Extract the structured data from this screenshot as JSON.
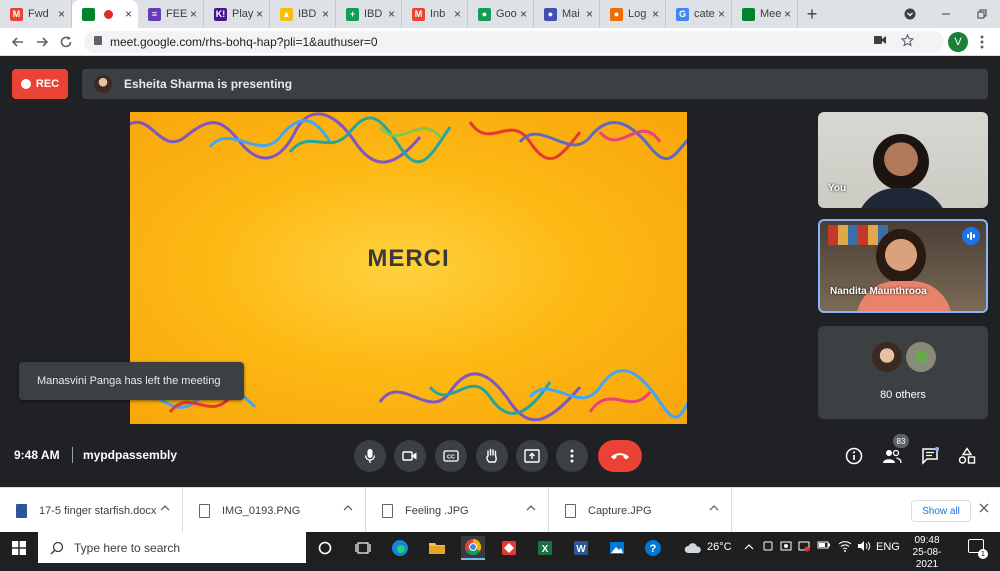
{
  "browser": {
    "tabs": [
      {
        "label": "Fwd",
        "icon": "gmail-icon",
        "color": "#ea4335",
        "glyph": "M"
      },
      {
        "label": "",
        "icon": "meet-icon",
        "color": "#00832d",
        "glyph": "",
        "active": true,
        "recording": true
      },
      {
        "label": "FEE",
        "icon": "forms-icon",
        "color": "#673ab7",
        "glyph": "≡"
      },
      {
        "label": "Play",
        "icon": "kahoot-icon",
        "color": "#46178f",
        "glyph": "K!"
      },
      {
        "label": "IBD",
        "icon": "drive-icon",
        "color": "#fbbc04",
        "glyph": "▲"
      },
      {
        "label": "IBD",
        "icon": "sheets-icon",
        "color": "#0f9d58",
        "glyph": "+"
      },
      {
        "label": "Inb",
        "icon": "gmail-icon",
        "color": "#ea4335",
        "glyph": "M"
      },
      {
        "label": "Goo",
        "icon": "google-icon",
        "color": "#0f9d58",
        "glyph": "●"
      },
      {
        "label": "Mai",
        "icon": "globe-icon",
        "color": "#3f51b5",
        "glyph": "●"
      },
      {
        "label": "Log",
        "icon": "login-icon",
        "color": "#ef6c00",
        "glyph": "●"
      },
      {
        "label": "cate",
        "icon": "google-g-icon",
        "color": "#4285f4",
        "glyph": "G"
      },
      {
        "label": "Mee",
        "icon": "meet-icon",
        "color": "#00832d",
        "glyph": ""
      }
    ],
    "new_tab_label": "+",
    "url": "meet.google.com/rhs-bohq-hap?pli=1&authuser=0",
    "profile_initial": "V"
  },
  "meet": {
    "rec_label": "REC",
    "presenting_text": "Esheita Sharma is presenting",
    "slide_title": "MERCI",
    "toast": "Manasvini Panga has left the meeting",
    "tiles": {
      "you": "You",
      "nandita": "Nandita Maunthrooa",
      "others": "80 others"
    },
    "time": "9:48 AM",
    "meeting_code": "mypdpassembly",
    "people_count": "83"
  },
  "downloads": {
    "items": [
      {
        "name": "17-5 finger starfish.docx",
        "kind": "word"
      },
      {
        "name": "IMG_0193.PNG",
        "kind": "file"
      },
      {
        "name": "Feeling .JPG",
        "kind": "file"
      },
      {
        "name": "Capture.JPG",
        "kind": "file"
      }
    ],
    "show_all": "Show all"
  },
  "taskbar": {
    "search_placeholder": "Type here to search",
    "weather": "26°C",
    "language": "ENG",
    "time": "09:48",
    "date": "25-08-2021",
    "notifications": "1"
  },
  "colors": {
    "meet_bg": "#202124",
    "rec_red": "#ea4335",
    "end_call": "#ea4335",
    "active_speaker": "#8ab4f8",
    "slide_orange": "#fdb914"
  }
}
